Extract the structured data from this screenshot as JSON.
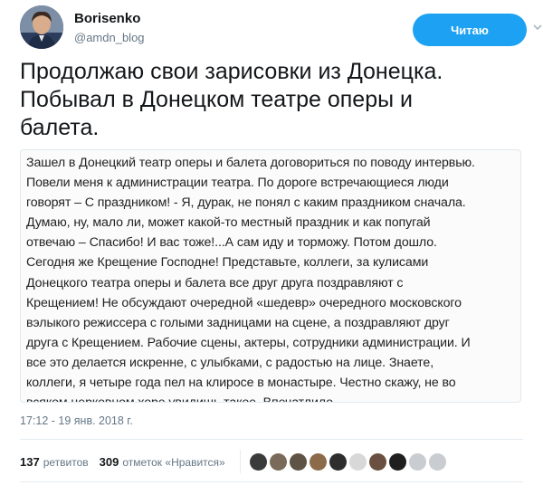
{
  "user": {
    "name": "Borisenko",
    "handle": "@amdn_blog",
    "follow_label": "Читаю"
  },
  "tweet": {
    "text_lines": [
      "Продолжаю свои зарисовки из Донецка.",
      "Побывал в Донецком театре оперы и",
      "балета."
    ],
    "image_text_lines": [
      "Зашел в Донецкий театр оперы и балета договориться по поводу интервью.",
      "Повели меня к администрации театра. По дороге встречающиеся люди",
      "говорят – С праздником! - Я, дурак, не понял с каким праздником сначала.",
      "Думаю, ну, мало ли, может какой-то местный праздник и как попугай",
      "отвечаю – Спасибо! И вас тоже!...А сам иду и торможу. Потом дошло.",
      "Сегодня же Крещение Господне! Представьте, коллеги, за кулисами",
      "Донецкого театра оперы и балета все друг друга поздравляют с",
      "Крещением! Не обсуждают очередной «шедевр» очередного московского",
      "вэлыкого режиссера с голыми задницами на сцене, а поздравляют друг",
      "друга с Крещением. Рабочие сцены, актеры, сотрудники администрации. И",
      "все это делается искренне, с улыбками, с радостью на лице. Знаете,",
      "коллеги, я четыре года пел на клиросе в монастыре. Честно скажу, не во",
      "всяком церковном хоре увидишь такое. Впечатлило."
    ],
    "timestamp": "17:12 - 19 янв. 2018 г."
  },
  "stats": {
    "retweets_count": "137",
    "retweets_label": "ретвитов",
    "likes_count": "309",
    "likes_label": "отметок «Нравится»"
  },
  "likers": [
    {
      "name": "liker-avatar-1",
      "color": "#3b3b3b"
    },
    {
      "name": "liker-avatar-2",
      "color": "#7a6a5a"
    },
    {
      "name": "liker-avatar-3",
      "color": "#5f5346"
    },
    {
      "name": "liker-avatar-4",
      "color": "#8c6b4a"
    },
    {
      "name": "liker-avatar-5",
      "color": "#2e2e2e"
    },
    {
      "name": "liker-avatar-6",
      "color": "#d8d8d8"
    },
    {
      "name": "liker-avatar-7",
      "color": "#6a5040"
    },
    {
      "name": "liker-avatar-8",
      "color": "#1f1f1f"
    },
    {
      "name": "liker-avatar-9",
      "color": "#c9ccd0"
    },
    {
      "name": "liker-avatar-10",
      "color": "#c9ccd0"
    }
  ],
  "colors": {
    "accent": "#1da1f2",
    "muted": "#657786"
  },
  "icons": [
    "chevron-down-icon",
    "person-icon"
  ]
}
